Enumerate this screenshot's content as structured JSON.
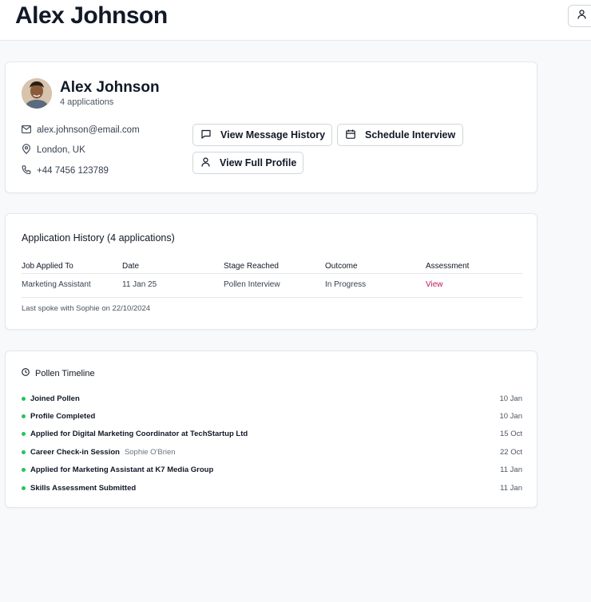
{
  "header": {
    "title": "Alex Johnson",
    "account_icon": "user-icon"
  },
  "profile": {
    "name": "Alex Johnson",
    "applications_count": "4 applications",
    "email": "alex.johnson@email.com",
    "location": "London, UK",
    "phone": "+44 7456 123789",
    "buttons": {
      "message_history": "View Message History",
      "schedule_interview": "Schedule Interview",
      "full_profile": "View Full Profile"
    }
  },
  "history": {
    "heading": "Application History (4 applications)",
    "columns": [
      "Job Applied To",
      "Date",
      "Stage Reached",
      "Outcome",
      "Assessment"
    ],
    "rows": [
      [
        "Marketing Assistant",
        "11 Jan 25",
        "Pollen Interview",
        "In Progress",
        "View"
      ]
    ],
    "last_spoke": "Last spoke with Sophie on 22/10/2024"
  },
  "timeline": {
    "heading": "Pollen Timeline",
    "items": [
      {
        "title": "Joined Pollen",
        "person": "",
        "date": "10 Jan"
      },
      {
        "title": "Profile Completed",
        "person": "",
        "date": "10 Jan"
      },
      {
        "title": "Applied for Digital Marketing Coordinator at TechStartup Ltd",
        "person": "",
        "date": "15 Oct"
      },
      {
        "title": "Career Check-in Session",
        "person": "Sophie O'Brien",
        "date": "22 Oct"
      },
      {
        "title": "Applied for Marketing Assistant at K7 Media Group",
        "person": "",
        "date": "11 Jan"
      },
      {
        "title": "Skills Assessment Submitted",
        "person": "",
        "date": "11 Jan"
      }
    ]
  },
  "colors": {
    "accent_link": "#be185d",
    "timeline_dot": "#22c55e"
  }
}
